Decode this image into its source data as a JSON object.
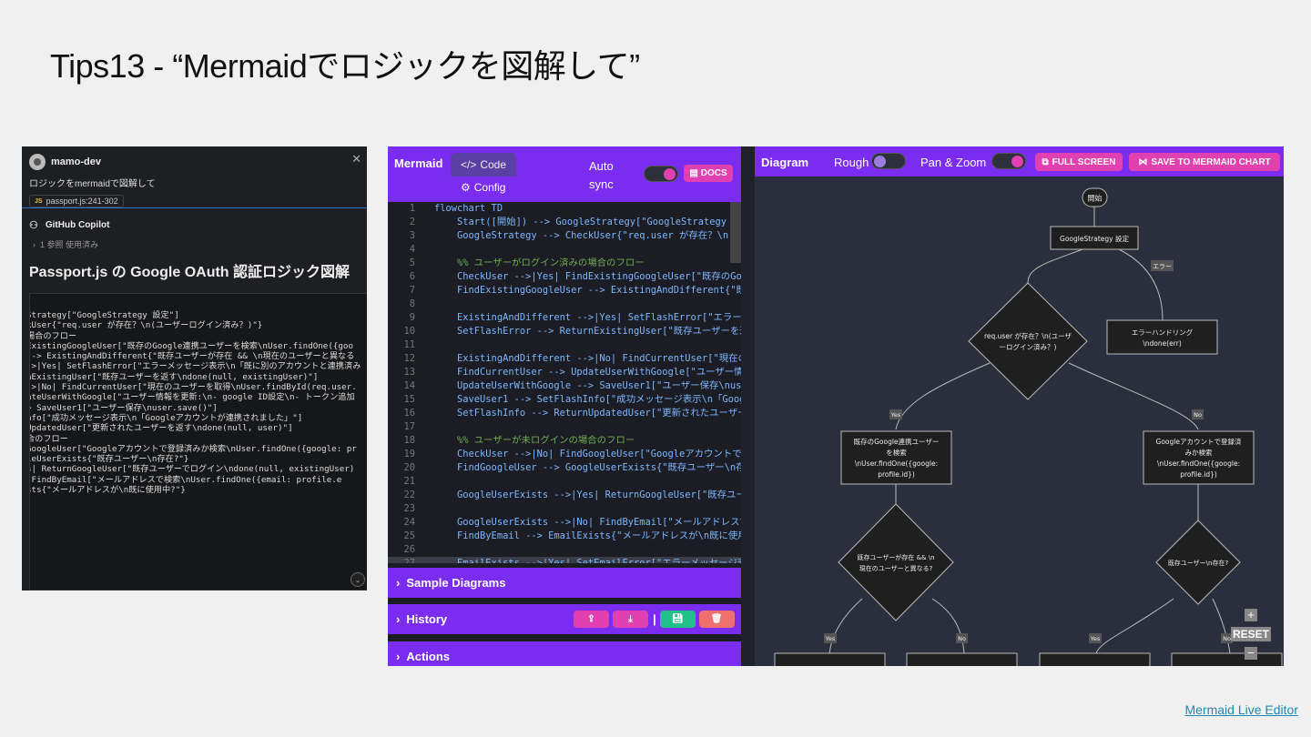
{
  "slide": {
    "title": "Tips13 - “Mermaidでロジックを図解して”",
    "footer_link": "Mermaid Live Editor"
  },
  "copilot": {
    "user": "mamo-dev",
    "prompt": "ロジックをmermaidで図解して",
    "file_badge_lang": "JS",
    "file_ref": "passport.js:241-302",
    "assistant_name": "GitHub Copilot",
    "reference": "1 参照 使用済み",
    "heading": "Passport.js の Google OAuth 認証ロジック図解",
    "code_lines": [
      "Strategy[\"GoogleStrategy 設定\"]",
      "kUser{\"req.user が存在？\\n(ユーザーログイン済み？)\"}",
      "",
      "場合のフロー",
      "ExistingGoogleUser[\"既存のGoogle連携ユーザーを検索\\nUser.findOne({goo",
      "--> ExistingAndDifferent{\"既存ユーザーが存在 && \\n現在のユーザーと異なる",
      "",
      "->|Yes| SetFlashError[\"エラーメッセージ表示\\n「既に別のアカウントと連携済み",
      "nExistingUser[\"既存ユーザーを返す\\ndone(null, existingUser)\"]",
      "",
      "->|No| FindCurrentUser[\"現在のユーザーを取得\\nUser.findById(req.user.",
      "ateUserWithGoogle[\"ユーザー情報を更新:\\n- google ID設定\\n- トークン追加",
      "> SaveUser1[\"ユーザー保存\\nuser.save()\"]",
      "nfo[\"成功メッセージ表示\\n「Googleアカウントが連携されました」\"]",
      "UpdatedUser[\"更新されたユーザーを返す\\ndone(null, user)\"]",
      "",
      "合のフロー",
      "GoogleUser[\"Googleアカウントで登録済みか検索\\nUser.findOne({google: pr",
      "leUserExists{\"既存ユーザー\\n存在?\"}",
      "",
      "s| ReturnGoogleUser[\"既存ユーザーでログイン\\ndone(null, existingUser)",
      "",
      " FindByEmail[\"メールアドレスで検索\\nUser.findOne({email: profile.e",
      "sts{\"メールアドレスが\\n既に使用中?\"}"
    ]
  },
  "editor": {
    "brand": "Mermaid",
    "tab_code": "Code",
    "tab_config": "Config",
    "auto_sync": "Auto sync",
    "docs": "DOCS",
    "code_lines": [
      {
        "n": "1",
        "t": "flowchart TD",
        "c": false
      },
      {
        "n": "2",
        "t": "    Start([開始]) --> GoogleStrategy[\"GoogleStrategy 設定\"",
        "c": false
      },
      {
        "n": "3",
        "t": "    GoogleStrategy --> CheckUser{\"req.user が存在？\\n(ユー",
        "c": false
      },
      {
        "n": "4",
        "t": "",
        "c": false
      },
      {
        "n": "5",
        "t": "    %% ユーザーがログイン済みの場合のフロー",
        "c": true
      },
      {
        "n": "6",
        "t": "    CheckUser -->|Yes| FindExistingGoogleUser[\"既存のGoog",
        "c": false
      },
      {
        "n": "7",
        "t": "    FindExistingGoogleUser --> ExistingAndDifferent{\"既存",
        "c": false
      },
      {
        "n": "8",
        "t": "",
        "c": false
      },
      {
        "n": "9",
        "t": "    ExistingAndDifferent -->|Yes| SetFlashError[\"エラーメ",
        "c": false
      },
      {
        "n": "10",
        "t": "    SetFlashError --> ReturnExistingUser[\"既存ユーザーを返",
        "c": false
      },
      {
        "n": "11",
        "t": "",
        "c": false
      },
      {
        "n": "12",
        "t": "    ExistingAndDifferent -->|No| FindCurrentUser[\"現在のユ",
        "c": false
      },
      {
        "n": "13",
        "t": "    FindCurrentUser --> UpdateUserWithGoogle[\"ユーザー情報",
        "c": false
      },
      {
        "n": "14",
        "t": "    UpdateUserWithGoogle --> SaveUser1[\"ユーザー保存\\nuser",
        "c": false
      },
      {
        "n": "15",
        "t": "    SaveUser1 --> SetFlashInfo[\"成功メッセージ表示\\n「Google",
        "c": false
      },
      {
        "n": "16",
        "t": "    SetFlashInfo --> ReturnUpdatedUser[\"更新されたユーザーを",
        "c": false
      },
      {
        "n": "17",
        "t": "",
        "c": false
      },
      {
        "n": "18",
        "t": "    %% ユーザーが未ログインの場合のフロー",
        "c": true
      },
      {
        "n": "19",
        "t": "    CheckUser -->|No| FindGoogleUser[\"Googleアカウントで登",
        "c": false
      },
      {
        "n": "20",
        "t": "    FindGoogleUser --> GoogleUserExists{\"既存ユーザー\\n存在",
        "c": false
      },
      {
        "n": "21",
        "t": "",
        "c": false
      },
      {
        "n": "22",
        "t": "    GoogleUserExists -->|Yes| ReturnGoogleUser[\"既存ユーザ",
        "c": false
      },
      {
        "n": "23",
        "t": "",
        "c": false
      },
      {
        "n": "24",
        "t": "    GoogleUserExists -->|No| FindByEmail[\"メールアドレスで検",
        "c": false
      },
      {
        "n": "25",
        "t": "    FindByEmail --> EmailExists{\"メールアドレスが\\n既に使用中",
        "c": false
      },
      {
        "n": "26",
        "t": "",
        "c": false
      },
      {
        "n": "27",
        "t": "    EmailExists -->|Yes| SetEmailError[\"エラーメッセージ表示",
        "c": false
      }
    ],
    "sample_diagrams": "Sample Diagrams",
    "history": "History",
    "actions": "Actions"
  },
  "diagram": {
    "title": "Diagram",
    "rough": "Rough",
    "pan_zoom": "Pan & Zoom",
    "full_screen": "FULL SCREEN",
    "save_chart": "SAVE TO MERMAID CHART",
    "reset": "RESET",
    "nodes": {
      "start": "開始",
      "strategy": "GoogleStrategy 設定",
      "error_edge": "エラー",
      "error_handling_1": "エラーハンドリング",
      "error_handling_2": "\\ndone(err)",
      "check_user_1": "req.user が存在？\\n(ユーザ",
      "check_user_2": "ーログイン済み？)",
      "yes": "Yes",
      "no": "No",
      "find_existing_1": "既存のGoogle連携ユーザー",
      "find_existing_2": "を検索",
      "find_existing_3": "\\nUser.findOne({google:",
      "find_existing_4": "profile.id})",
      "find_google_1": "Googleアカウントで登録済",
      "find_google_2": "みか検索",
      "find_google_3": "\\nUser.findOne({google:",
      "find_google_4": "profile.id})",
      "existing_diff_1": "既存ユーザーが存在 && \\n",
      "existing_diff_2": "現在のユーザーと異なる?",
      "google_user_exists": "既存ユーザー\\n存在?"
    }
  },
  "colors": {
    "purple": "#7a2cf0",
    "pink": "#e040b0",
    "green": "#22c08a",
    "salmon": "#f07070",
    "diagram_bg": "#2b2f3d",
    "node_fill": "#1f1f1f"
  }
}
